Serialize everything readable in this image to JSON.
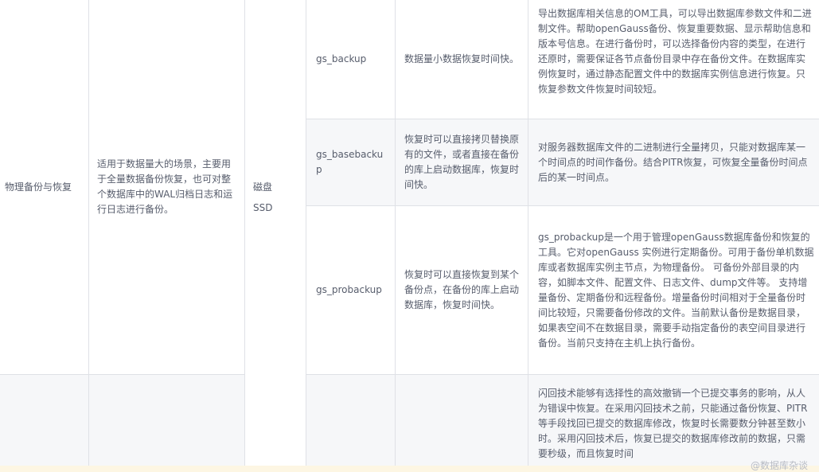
{
  "table": {
    "row_physical": {
      "category": "物理备份与恢复",
      "scenario": "适用于数据量大的场景，主要用于全量数据备份恢复，也可对整个数据库中的WAL归档日志和运行日志进行备份。",
      "medium_line1": "磁盘",
      "medium_line2": "SSD",
      "tools": [
        {
          "tool": "gs_backup",
          "feature": "数据量小数据恢复时间快。",
          "description": "导出数据库相关信息的OM工具，可以导出数据库参数文件和二进制文件。帮助openGauss备份、恢复重要数据、显示帮助信息和版本号信息。在进行备份时，可以选择备份内容的类型，在进行还原时，需要保证各节点备份目录中存在备份文件。在数据库实例恢复时，通过静态配置文件中的数据库实例信息进行恢复。只恢复参数文件恢复时间较短。"
        },
        {
          "tool": "gs_basebackup",
          "feature": "恢复时可以直接拷贝替换原有的文件，或者直接在备份的库上启动数据库，恢复时间快。",
          "description": "对服务器数据库文件的二进制进行全量拷贝，只能对数据库某一个时间点的时间作备份。结合PITR恢复，可恢复全量备份时间点后的某一时间点。"
        },
        {
          "tool": "gs_probackup",
          "feature": "恢复时可以直接恢复到某个备份点，在备份的库上启动数据库，恢复时间快。",
          "description": "gs_probackup是一个用于管理openGauss数据库备份和恢复的工具。它对openGauss 实例进行定期备份。可用于备份单机数据库或者数据库实例主节点，为物理备份。 可备份外部目录的内容，如脚本文件、配置文件、日志文件、dump文件等。 支持增量备份、定期备份和远程备份。增量备份时间相对于全量备份时间比较短，只需要备份修改的文件。当前默认备份是数据目录，如果表空间不在数据目录，需要手动指定备份的表空间目录进行备份。当前只支持在主机上执行备份。"
        }
      ]
    },
    "row_flashback": {
      "description": "闪回技术能够有选择性的高效撤销一个已提交事务的影响，从人为错误中恢复。在采用闪回技术之前，只能通过备份恢复、PITR等手段找回已提交的数据库修改，恢复时长需要数分钟甚至数小时。采用闪回技术后，恢复已提交的数据库修改前的数据，只需要秒级，而且恢复时间"
    }
  },
  "watermark": "@数据库杂谈"
}
